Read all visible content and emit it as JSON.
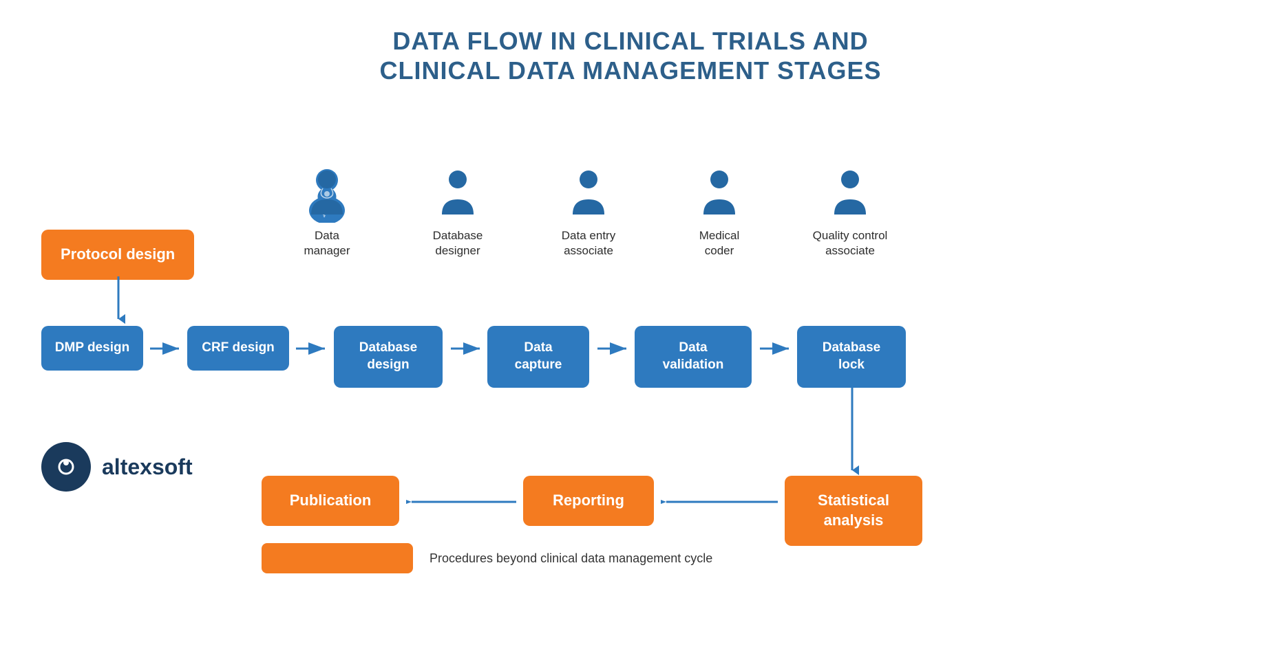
{
  "title": {
    "line1": "DATA FLOW IN CLINICAL TRIALS AND",
    "line2": "CLINICAL DATA MANAGEMENT STAGES"
  },
  "roles": [
    {
      "label": "Data\nmanager"
    },
    {
      "label": "Database\ndesigner"
    },
    {
      "label": "Data entry\nassociate"
    },
    {
      "label": "Medical\ncoder"
    },
    {
      "label": "Quality control\nassociate"
    }
  ],
  "protocol_box": "Protocol design",
  "process_boxes": [
    "DMP design",
    "CRF design",
    "Database\ndesign",
    "Data\ncapture",
    "Data\nvalidation",
    "Database\nlock"
  ],
  "bottom_boxes": [
    "Publication",
    "Reporting",
    "Statistical\nanalysis"
  ],
  "legend_text": "Procedures beyond clinical data management cycle",
  "logo_name": "altexsoft",
  "colors": {
    "blue": "#2e7abf",
    "orange": "#f47b20",
    "dark_blue": "#1a3a5c",
    "text_dark": "#2d2d2d",
    "title_blue": "#2d5f8a"
  }
}
